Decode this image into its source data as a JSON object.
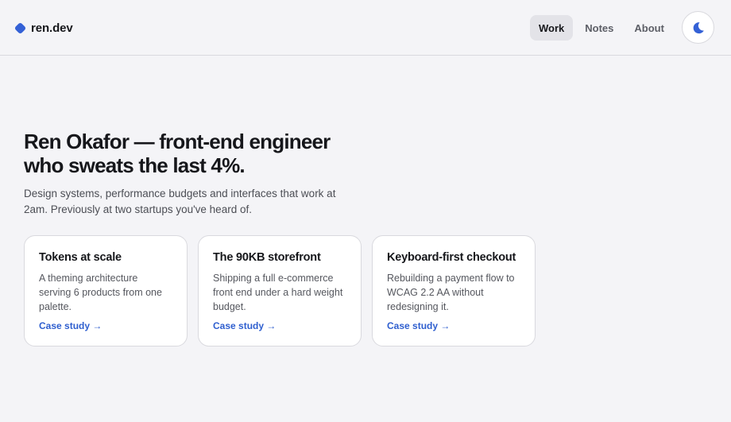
{
  "brand": {
    "name": "ren.dev",
    "accent": "#3461d6"
  },
  "nav": {
    "items": [
      {
        "label": "Work",
        "active": true
      },
      {
        "label": "Notes",
        "active": false
      },
      {
        "label": "About",
        "active": false
      }
    ],
    "theme_toggle_icon": "half-moon-icon"
  },
  "hero": {
    "title_line1": "Ren Okafor — front-end engineer",
    "title_line2": "who sweats the last 4%.",
    "subtitle": "Design systems, performance budgets and interfaces that work at 2am. Previously at two startups you've heard of."
  },
  "cards": [
    {
      "title": "Tokens at scale",
      "description": "A theming architecture serving 6 products from one palette.",
      "link": "Case study →"
    },
    {
      "title": "The 90KB storefront",
      "description": "Shipping a full e-commerce front end under a hard weight budget.",
      "link": "Case study →"
    },
    {
      "title": "Keyboard-first checkout",
      "description": "Rebuilding a payment flow to WCAG 2.2 AA without redesigning it.",
      "link": "Case study →"
    }
  ]
}
